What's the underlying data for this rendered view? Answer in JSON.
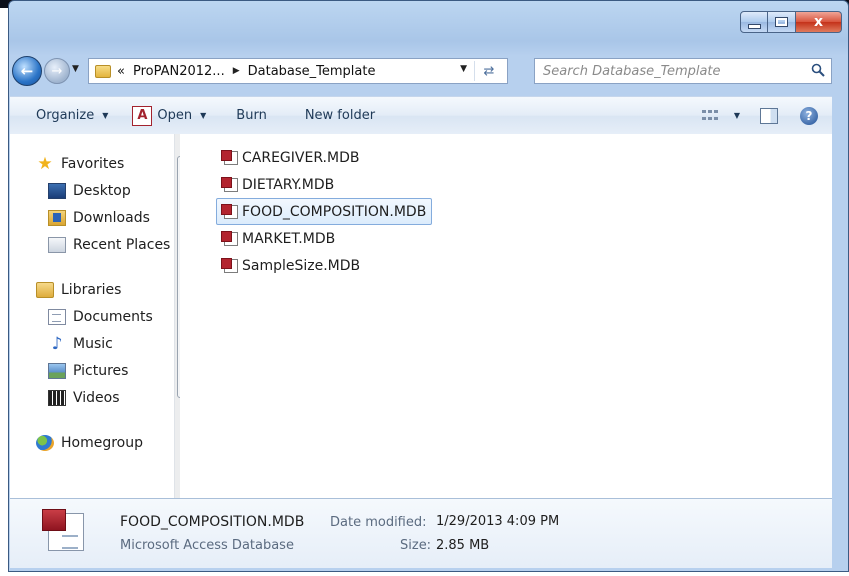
{
  "window": {
    "caption": {
      "minimize_icon": "minimize-icon",
      "maximize_icon": "maximize-icon",
      "close_label": "x"
    }
  },
  "address": {
    "overflow": "«",
    "crumbs": [
      "ProPAN2012...",
      "Database_Template"
    ]
  },
  "search": {
    "placeholder": "Search Database_Template"
  },
  "toolbar": {
    "organize": "Organize",
    "open": "Open",
    "open_icon_letter": "A",
    "burn": "Burn",
    "new_folder": "New folder",
    "help": "?"
  },
  "nav": {
    "favorites": {
      "label": "Favorites",
      "items": [
        "Desktop",
        "Downloads",
        "Recent Places"
      ]
    },
    "libraries": {
      "label": "Libraries",
      "items": [
        "Documents",
        "Music",
        "Pictures",
        "Videos"
      ]
    },
    "homegroup": "Homegroup"
  },
  "files": [
    {
      "name": "CAREGIVER.MDB",
      "selected": false
    },
    {
      "name": "DIETARY.MDB",
      "selected": false
    },
    {
      "name": "FOOD_COMPOSITION.MDB",
      "selected": true
    },
    {
      "name": "MARKET.MDB",
      "selected": false
    },
    {
      "name": "SampleSize.MDB",
      "selected": false
    }
  ],
  "details": {
    "name": "FOOD_COMPOSITION.MDB",
    "type": "Microsoft Access Database",
    "modified_label": "Date modified:",
    "modified_value": "1/29/2013 4:09 PM",
    "size_label": "Size:",
    "size_value": "2.85 MB"
  },
  "colors": {
    "selection_bg": "#dcecfc",
    "selection_border": "#84acdd",
    "access_red": "#b3242f"
  }
}
